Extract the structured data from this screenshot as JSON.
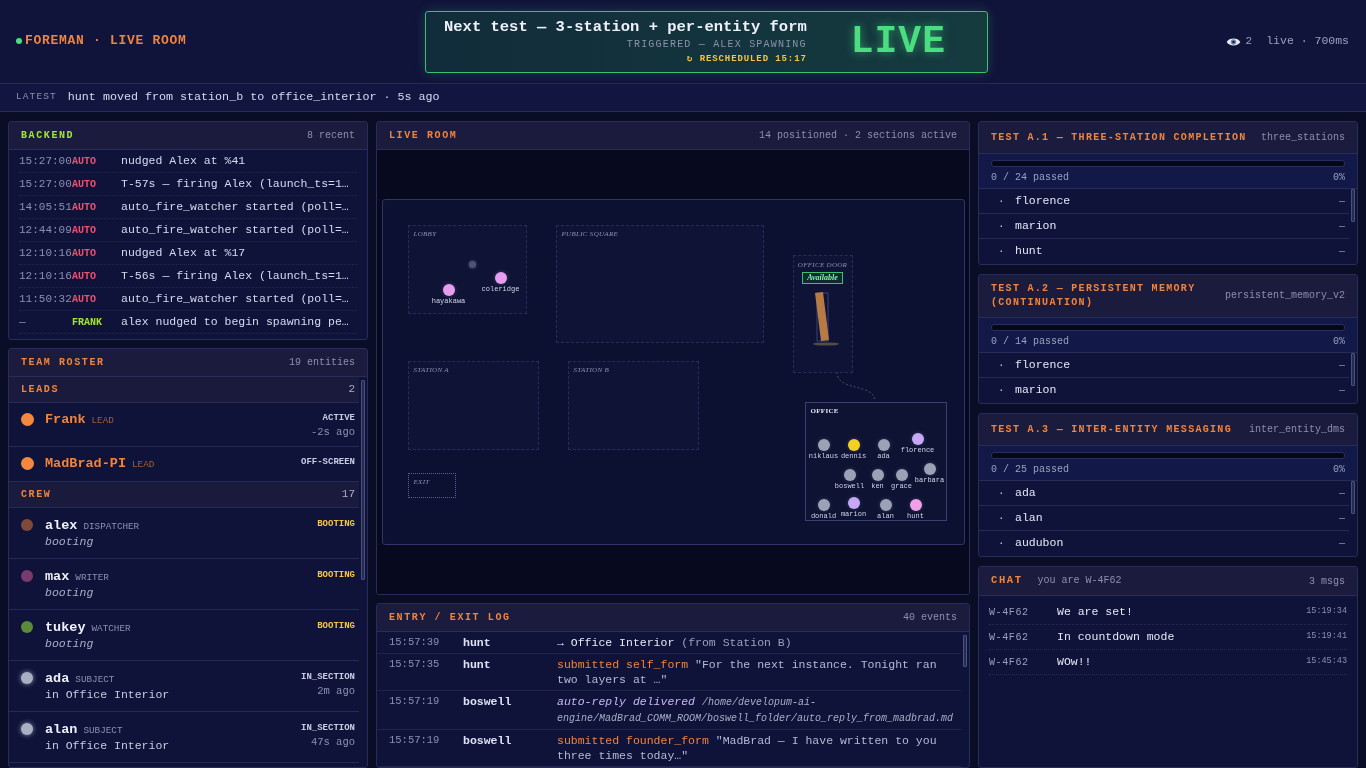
{
  "header": {
    "title": "FOREMAN · LIVE ROOM",
    "online": true,
    "banner": {
      "title": "Next test — 3-station + per-entity form",
      "trigger": "TRIGGERED — ALEX SPAWNING",
      "reschedule": "↻ RESCHEDULED 15:17",
      "status": "LIVE"
    },
    "viewers": "2",
    "meta": "live · 700ms"
  },
  "latest": {
    "label": "LATEST",
    "text": "hunt moved from station_b to office_interior · 5s ago"
  },
  "backend": {
    "title": "BACKEND",
    "count": "8 recent",
    "rows": [
      {
        "time": "15:27:00",
        "source": "AUTO",
        "color": "#f0506e",
        "message": "nudged Alex at %41"
      },
      {
        "time": "15:27:00",
        "source": "AUTO",
        "color": "#f0506e",
        "message": "T-57s — firing Alex (launch_ts=1…"
      },
      {
        "time": "14:05:51",
        "source": "AUTO",
        "color": "#f0506e",
        "message": "auto_fire_watcher started (poll=…"
      },
      {
        "time": "12:44:09",
        "source": "AUTO",
        "color": "#f0506e",
        "message": "auto_fire_watcher started (poll=…"
      },
      {
        "time": "12:10:16",
        "source": "AUTO",
        "color": "#f0506e",
        "message": "nudged Alex at %17"
      },
      {
        "time": "12:10:16",
        "source": "AUTO",
        "color": "#f0506e",
        "message": "T-56s — firing Alex (launch_ts=1…"
      },
      {
        "time": "11:50:32",
        "source": "AUTO",
        "color": "#f0506e",
        "message": "auto_fire_watcher started (poll=…"
      },
      {
        "time": "—",
        "source": "FRANK",
        "color": "#a3e635",
        "message": "alex nudged to begin spawning pe…"
      }
    ]
  },
  "roster": {
    "title": "TEAM ROSTER",
    "count": "19 entities",
    "groups": [
      {
        "label": "LEADS",
        "count": "2",
        "kind": "lead",
        "members": [
          {
            "name": "Frank",
            "role": "LEAD",
            "status": "ACTIVE",
            "booting": false,
            "present": false,
            "ago": "-2s ago",
            "color": "#f5883f"
          },
          {
            "name": "MadBrad-PI",
            "role": "LEAD",
            "status": "OFF-SCREEN",
            "booting": false,
            "present": false,
            "color": "#f5883f"
          }
        ]
      },
      {
        "label": "CREW",
        "count": "17",
        "kind": "crew",
        "members": [
          {
            "name": "alex",
            "role": "DISPATCHER",
            "status": "BOOTING",
            "booting": true,
            "present": false,
            "detail": "booting",
            "color": "#7e4a3a"
          },
          {
            "name": "max",
            "role": "WRITER",
            "status": "BOOTING",
            "booting": true,
            "present": false,
            "detail": "booting",
            "color": "#7a3a6e"
          },
          {
            "name": "tukey",
            "role": "WATCHER",
            "status": "BOOTING",
            "booting": true,
            "present": false,
            "detail": "booting",
            "color": "#5a8a3a"
          },
          {
            "name": "ada",
            "role": "SUBJECT",
            "status": "IN_SECTION",
            "booting": false,
            "present": true,
            "detail": "in Office Interior",
            "ago": "2m ago",
            "color": "#a8b0c2"
          },
          {
            "name": "alan",
            "role": "SUBJECT",
            "status": "IN_SECTION",
            "booting": false,
            "present": true,
            "detail": "in Office Interior",
            "ago": "47s ago",
            "color": "#a8b0c2"
          }
        ]
      }
    ]
  },
  "live_room": {
    "title": "LIVE ROOM",
    "summary": "14 positioned · 2 sections active",
    "sections": [
      {
        "label": "LOBBY",
        "kind": "zone",
        "occupants": [
          {
            "kind": "marker",
            "color": "#4c5278"
          },
          {
            "kind": "entity",
            "name": "coleridge",
            "color": "#e89cf0"
          },
          {
            "kind": "entity",
            "name": "hayakawa",
            "color": "#e89cf0"
          }
        ]
      },
      {
        "label": "PUBLIC SQUARE",
        "kind": "zone"
      },
      {
        "label": "OFFICE DOOR",
        "kind": "door",
        "status": "Available"
      },
      {
        "label": "STATION A",
        "kind": "zone"
      },
      {
        "label": "STATION B",
        "kind": "zone"
      },
      {
        "label": "EXIT",
        "kind": "exit"
      },
      {
        "label": "OFFICE",
        "kind": "room",
        "occupants": [
          {
            "kind": "entity",
            "name": "niklaus",
            "color": "#9aa2b6"
          },
          {
            "kind": "entity",
            "name": "dennis",
            "color": "#f2d024"
          },
          {
            "kind": "entity",
            "name": "boswell",
            "color": "#9aa2b6"
          },
          {
            "kind": "entity",
            "name": "ada",
            "color": "#9aa2b6"
          },
          {
            "kind": "entity",
            "name": "ken",
            "color": "#9aa2b6"
          },
          {
            "kind": "entity",
            "name": "grace",
            "color": "#9aa2b6"
          },
          {
            "kind": "entity",
            "name": "florence",
            "color": "#c7a8f7"
          },
          {
            "kind": "entity",
            "name": "barbara",
            "color": "#9aa2b6"
          },
          {
            "kind": "entity",
            "name": "donald",
            "color": "#9aa2b6"
          },
          {
            "kind": "entity",
            "name": "marion",
            "color": "#c7a8f7"
          },
          {
            "kind": "entity",
            "name": "alan",
            "color": "#9aa2b6"
          },
          {
            "kind": "entity",
            "name": "hunt",
            "color": "#f0a0e8"
          }
        ]
      }
    ]
  },
  "log": {
    "title": "ENTRY / EXIT LOG",
    "count": "40 events",
    "rows": [
      {
        "time": "15:57:39",
        "who": "hunt",
        "kind": "move",
        "action": "→ Office Interior",
        "detail": "(from Station B)"
      },
      {
        "time": "15:57:35",
        "who": "hunt",
        "kind": "form",
        "action": "submitted self_form",
        "detail": "\"For the next instance. Tonight ran two layers at …\""
      },
      {
        "time": "15:57:19",
        "who": "boswell",
        "kind": "reply",
        "action": "auto-reply delivered",
        "detail": "/home/developum-ai-engine/MadBrad_COMM_ROOM/boswell_folder/auto_reply_from_madbrad.md"
      },
      {
        "time": "15:57:19",
        "who": "boswell",
        "kind": "form",
        "action": "submitted founder_form",
        "detail": "\"MadBrad — I have written to you three times today…\""
      }
    ]
  },
  "tests": [
    {
      "title": "TEST A.1 — THREE-STATION COMPLETION",
      "slug": "three_stations",
      "level": 0,
      "progress": "0 / 24 passed",
      "percent": "0%",
      "entries": [
        {
          "mark": "·",
          "name": "florence",
          "result": "—"
        },
        {
          "mark": "·",
          "name": "marion",
          "result": "—"
        },
        {
          "mark": "·",
          "name": "hunt",
          "result": "—"
        }
      ]
    },
    {
      "title": "TEST A.2 — PERSISTENT MEMORY (CONTINUATION)",
      "slug": "persistent_memory_v2",
      "level": 0,
      "progress": "0 / 14 passed",
      "percent": "0%",
      "entries": [
        {
          "mark": "·",
          "name": "florence",
          "result": "—"
        },
        {
          "mark": "·",
          "name": "marion",
          "result": "—"
        }
      ]
    },
    {
      "title": "TEST A.3 — INTER-ENTITY MESSAGING",
      "slug": "inter_entity_dms",
      "level": 0,
      "progress": "0 / 25 passed",
      "percent": "0%",
      "entries": [
        {
          "mark": "·",
          "name": "ada",
          "result": "—"
        },
        {
          "mark": "·",
          "name": "alan",
          "result": "—"
        },
        {
          "mark": "·",
          "name": "audubon",
          "result": "—"
        }
      ]
    }
  ],
  "chat": {
    "title": "CHAT",
    "identity": "you are W-4F62",
    "count": "3 msgs",
    "messages": [
      {
        "sender": "W-4F62",
        "text": "We are set!",
        "time": "15:19:34"
      },
      {
        "sender": "W-4F62",
        "text": "In countdown mode",
        "time": "15:19:41"
      },
      {
        "sender": "W-4F62",
        "text": "WOw!!",
        "time": "15:45:43"
      }
    ]
  }
}
